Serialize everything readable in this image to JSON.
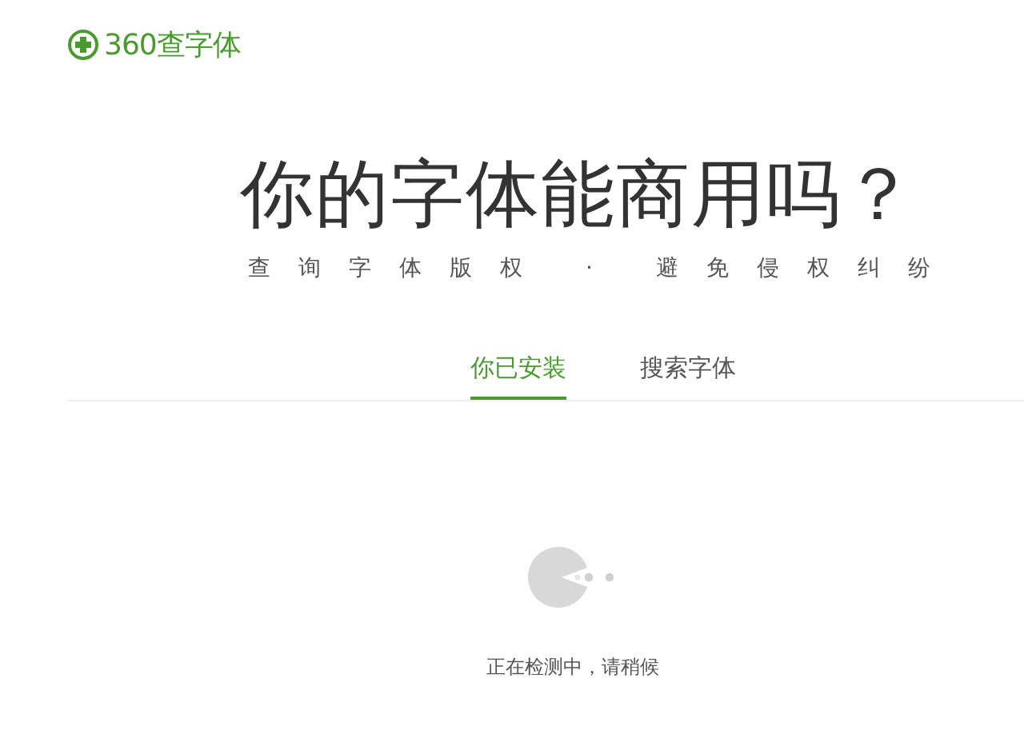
{
  "logo": {
    "text": "360查字体"
  },
  "hero": {
    "title": "你的字体能商用吗？",
    "subtitle": "查询字体版权 · 避免侵权纠纷"
  },
  "tabs": [
    {
      "label": "你已安装",
      "selected": true
    },
    {
      "label": "搜索字体",
      "selected": false
    }
  ],
  "status": {
    "text": "正在检测中，请稍候"
  }
}
